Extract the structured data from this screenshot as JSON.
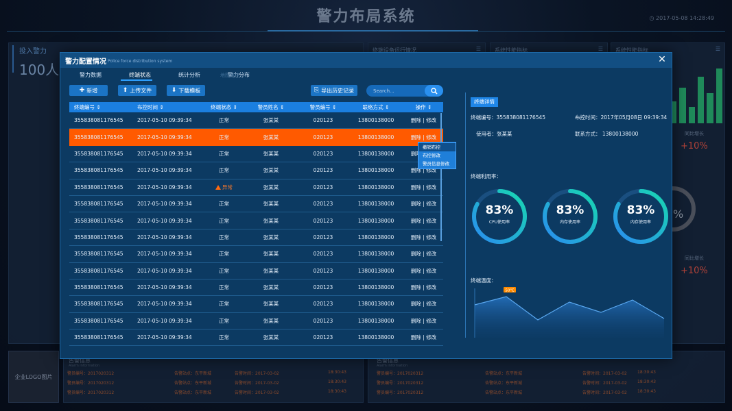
{
  "background": {
    "title": "警力布局系统",
    "datetime": "2017-05-08 14:28:49",
    "panels": {
      "deploy_title": "投入警力",
      "deploy_value": "100人",
      "terminal_status_title": "终端设备运行情况",
      "perf1_title": "系统性能指标",
      "perf2_title": "系统性能指标",
      "growth_label_1": "同比增长",
      "growth_value_1": "+10%",
      "growth_label_2": "同比增长",
      "growth_value_2": "+10%",
      "ring_value": "%",
      "logo": "企业LOGO图片",
      "alert_title": "告警信息",
      "alert_sub": "Alarm information",
      "alert_rows_left": [
        {
          "a": "警员编号：2017020312",
          "b": "告警站点：东平新城",
          "c": "告警时间：2017-03-02",
          "d": "18:30:43"
        },
        {
          "a": "警员编号：2017020312",
          "b": "告警站点：东平新城",
          "c": "告警时间：2017-03-02",
          "d": "18:30:43"
        },
        {
          "a": "警员编号：2017020312",
          "b": "告警站点：东平新城",
          "c": "告警时间：2017-03-02",
          "d": "18:30:43"
        }
      ],
      "alert_rows_right": [
        {
          "a": "警员编号：2017020312",
          "b": "告警站点：东平新城",
          "c": "告警时间：2017-03-02",
          "d": "18:30:43"
        },
        {
          "a": "警员编号：2017020312",
          "b": "告警站点：东平新城",
          "c": "告警时间：2017-03-02",
          "d": "18:30:43"
        },
        {
          "a": "警员编号：2017020312",
          "b": "告警站点：东平新城",
          "c": "告警时间：2017-03-02",
          "d": "18:30:43"
        }
      ]
    }
  },
  "modal": {
    "title": "警力配置情况",
    "subtitle": "Police force distribution system",
    "tabs": [
      "警力数据",
      "终端状态",
      "统计分析",
      "警力分布"
    ],
    "active_tab": 1,
    "ghost_tab": "地图监控",
    "buttons": {
      "add": "新增",
      "upload": "上传文件",
      "download": "下载模板",
      "export": "导出历史记录"
    },
    "search_placeholder": "Search...",
    "table": {
      "headers": [
        "终端编号",
        "布控时间",
        "终端状态",
        "警员姓名",
        "警员编号",
        "联络方式",
        "操作"
      ],
      "rows": [
        {
          "id": "355838081176545",
          "time": "2017-05-10  09:39:34",
          "status": "正常",
          "name": "张某某",
          "no": "020123",
          "phone": "13800138000",
          "op": "删除 | 修改"
        },
        {
          "id": "355838081176545",
          "time": "2017-05-10  09:39:34",
          "status": "正常",
          "name": "张某某",
          "no": "020123",
          "phone": "13800138000",
          "op": "删除 | 修改"
        },
        {
          "id": "355838081176545",
          "time": "2017-05-10  09:39:34",
          "status": "正常",
          "name": "张某某",
          "no": "020123",
          "phone": "13800138000",
          "op": "删除 | 修改"
        },
        {
          "id": "355838081176545",
          "time": "2017-05-10  09:39:34",
          "status": "正常",
          "name": "张某某",
          "no": "020123",
          "phone": "13800138000",
          "op": "删除 | 修改"
        },
        {
          "id": "355838081176545",
          "time": "2017-05-10  09:39:34",
          "status": "异常",
          "name": "张某某",
          "no": "020123",
          "phone": "13800138000",
          "op": "删除 | 修改"
        },
        {
          "id": "355838081176545",
          "time": "2017-05-10  09:39:34",
          "status": "正常",
          "name": "张某某",
          "no": "020123",
          "phone": "13800138000",
          "op": "删除 | 修改"
        },
        {
          "id": "355838081176545",
          "time": "2017-05-10  09:39:34",
          "status": "正常",
          "name": "张某某",
          "no": "020123",
          "phone": "13800138000",
          "op": "删除 | 修改"
        },
        {
          "id": "355838081176545",
          "time": "2017-05-10  09:39:34",
          "status": "正常",
          "name": "张某某",
          "no": "020123",
          "phone": "13800138000",
          "op": "删除 | 修改"
        },
        {
          "id": "355838081176545",
          "time": "2017-05-10  09:39:34",
          "status": "正常",
          "name": "张某某",
          "no": "020123",
          "phone": "13800138000",
          "op": "删除 | 修改"
        },
        {
          "id": "355838081176545",
          "time": "2017-05-10  09:39:34",
          "status": "正常",
          "name": "张某某",
          "no": "020123",
          "phone": "13800138000",
          "op": "删除 | 修改"
        },
        {
          "id": "355838081176545",
          "time": "2017-05-10  09:39:34",
          "status": "正常",
          "name": "张某某",
          "no": "020123",
          "phone": "13800138000",
          "op": "删除 | 修改"
        },
        {
          "id": "355838081176545",
          "time": "2017-05-10  09:39:34",
          "status": "正常",
          "name": "张某某",
          "no": "020123",
          "phone": "13800138000",
          "op": "删除 | 修改"
        },
        {
          "id": "355838081176545",
          "time": "2017-05-10  09:39:34",
          "status": "正常",
          "name": "张某某",
          "no": "020123",
          "phone": "13800138000",
          "op": "删除 | 修改"
        },
        {
          "id": "355838081176545",
          "time": "2017-05-10  09:39:34",
          "status": "正常",
          "name": "张某某",
          "no": "020123",
          "phone": "13800138000",
          "op": "删除 | 修改"
        }
      ],
      "highlight_row": 1
    },
    "context_menu": [
      "撤销布控",
      "布控修改",
      "警员信息修改"
    ],
    "detail": {
      "tag": "终端详情",
      "terminal_id": "终端编号：355838081176545",
      "deploy_time": "布控时间：2017年05月08日 09:39:34",
      "user": "使用者：张某某",
      "contact": "联系方式：  13800138000",
      "usage_title": "终端利用率：",
      "rings": [
        {
          "value": "83%",
          "label": "CPU使用率",
          "pct": 83
        },
        {
          "value": "83%",
          "label": "内存使用率",
          "pct": 83
        },
        {
          "value": "83%",
          "label": "内存使用率",
          "pct": 83
        }
      ],
      "temp_title": "终端温度：",
      "temp_marker": "50℃"
    },
    "temperature_series": [
      40,
      52,
      18,
      44,
      29,
      47,
      20
    ],
    "colors": {
      "accent": "#1b7fe0",
      "highlight": "#ff5a00",
      "warning": "#ff6a10",
      "ring_gradient_start": "#2a8cf0",
      "ring_gradient_end": "#18d8b0"
    }
  }
}
